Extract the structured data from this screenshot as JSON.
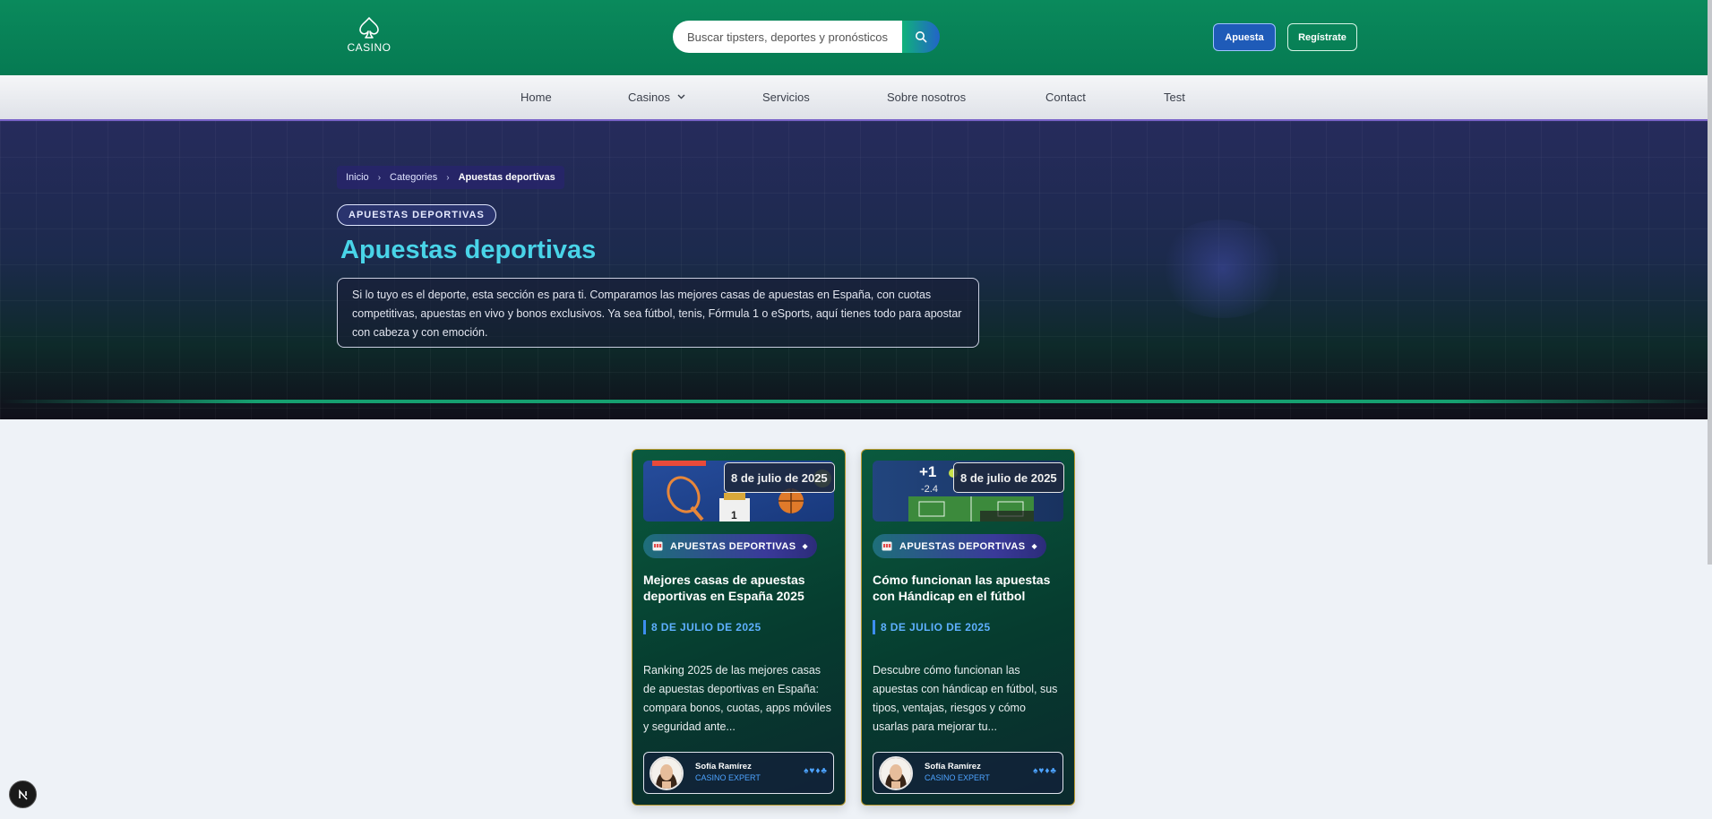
{
  "header": {
    "logo_text": "CASINO",
    "search_placeholder": "Buscar tipsters, deportes y pronósticos...",
    "apuesta_label": "Apuesta",
    "registrate_label": "Regístrate"
  },
  "nav": {
    "items": [
      {
        "label": "Home"
      },
      {
        "label": "Casinos"
      },
      {
        "label": "Servicios"
      },
      {
        "label": "Sobre nosotros"
      },
      {
        "label": "Contact"
      },
      {
        "label": "Test"
      }
    ]
  },
  "hero": {
    "breadcrumb": [
      "Inicio",
      "Categories",
      "Apuestas deportivas"
    ],
    "badge": "APUESTAS DEPORTIVAS",
    "title": "Apuestas deportivas",
    "description": "Si lo tuyo es el deporte, esta sección es para ti. Comparamos las mejores casas de apuestas en España, con cuotas competitivas, apuestas en vivo y bonos exclusivos. Ya sea fútbol, tenis, Fórmula 1 o eSports, aquí tienes todo para apostar con cabeza y con emoción."
  },
  "cards": [
    {
      "date_badge": "8 de julio de 2025",
      "category": "APUESTAS DEPORTIVAS",
      "title": "Mejores casas de apuestas deportivas en España 2025",
      "date": "8 DE JULIO DE 2025",
      "excerpt": "Ranking 2025 de las mejores casas de apuestas deportivas en España: compara bonos, cuotas, apps móviles y seguridad ante...",
      "author_name": "Sofía Ramírez",
      "author_role": "CASINO EXPERT",
      "suits": "♠♥♦♣"
    },
    {
      "date_badge": "8 de julio de 2025",
      "category": "APUESTAS DEPORTIVAS",
      "title": "Cómo funcionan las apuestas con Hándicap en el fútbol",
      "date": "8 DE JULIO DE 2025",
      "excerpt": "Descubre cómo funcionan las apuestas con hándicap en fútbol, sus tipos, ventajas, riesgos y cómo usarlas para mejorar tu...",
      "author_name": "Sofía Ramírez",
      "author_role": "CASINO EXPERT",
      "suits": "♠♥♦♣",
      "image_text": [
        "+1",
        "-2.4"
      ]
    }
  ],
  "colors": {
    "header_green": "#0a8a5c",
    "accent_cyan": "#49d4e8",
    "date_blue": "#5eb0ff"
  }
}
